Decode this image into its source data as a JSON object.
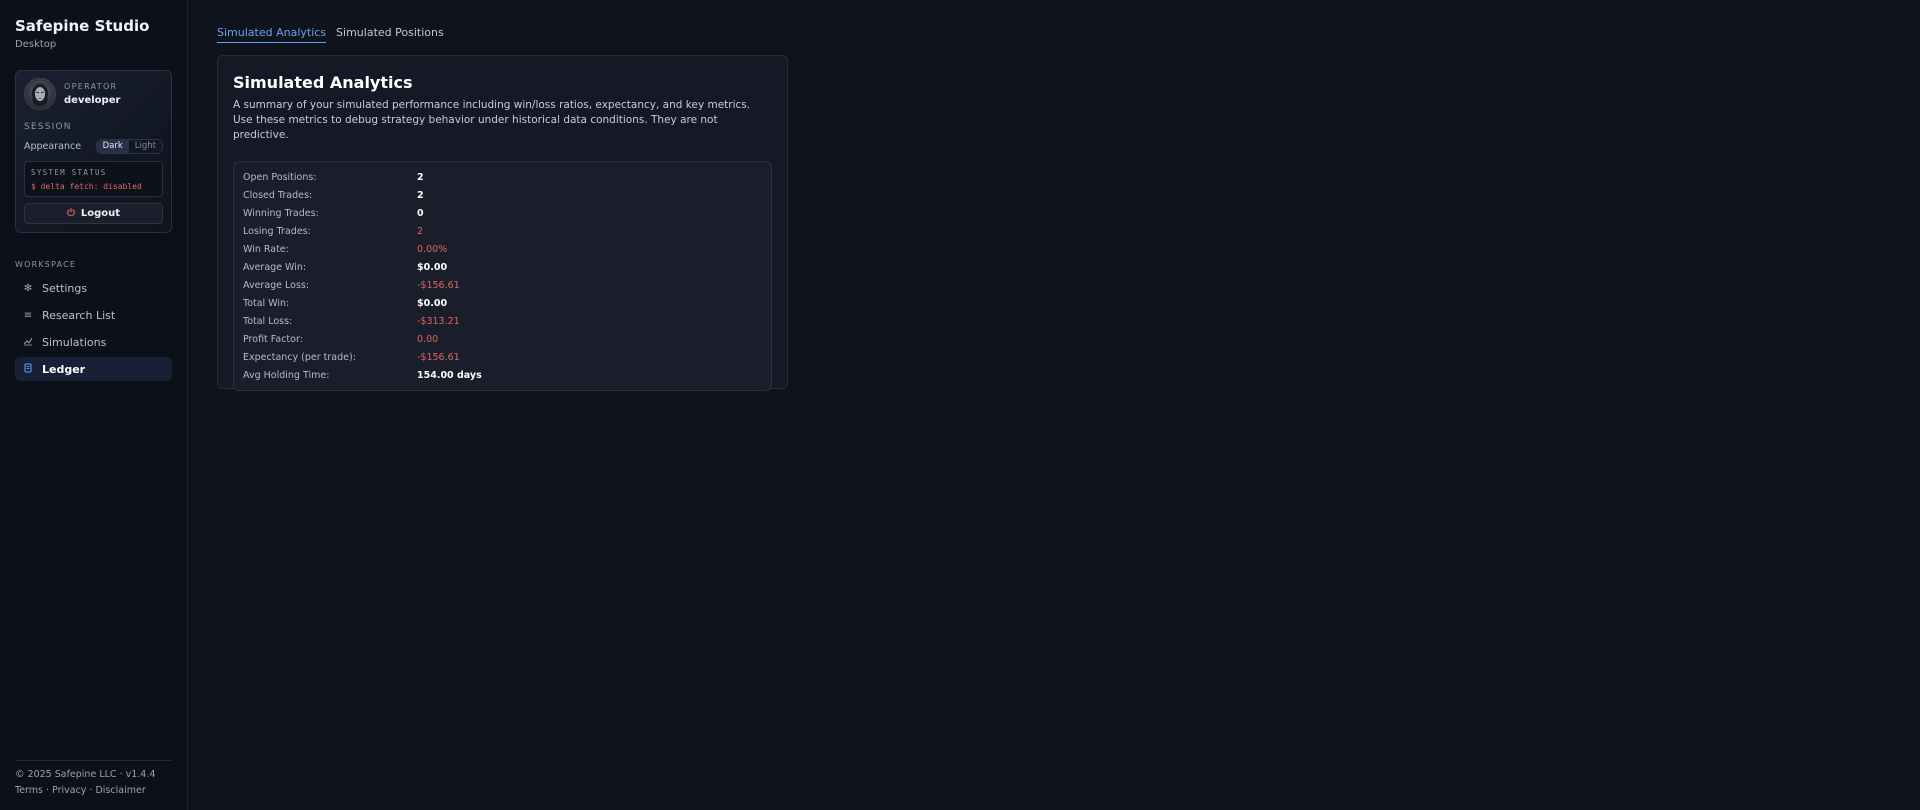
{
  "brand": {
    "title": "Safepine Studio",
    "subtitle": "Desktop"
  },
  "user": {
    "operator_label": "OPERATOR",
    "name": "developer"
  },
  "session": {
    "label": "SESSION",
    "appearance_label": "Appearance",
    "appearance_options": [
      "Dark",
      "Light"
    ],
    "appearance_selected": "Dark",
    "status_label": "SYSTEM STATUS",
    "status_line": "$ delta fetch: disabled",
    "logout_label": "Logout"
  },
  "workspace": {
    "label": "WORKSPACE",
    "items": [
      {
        "label": "Settings",
        "icon": "gear-icon",
        "active": false
      },
      {
        "label": "Research List",
        "icon": "list-icon",
        "active": false
      },
      {
        "label": "Simulations",
        "icon": "chart-icon",
        "active": false
      },
      {
        "label": "Ledger",
        "icon": "book-icon",
        "active": true
      }
    ]
  },
  "footer": {
    "copyright": "© 2025 Safepine LLC · v1.4.4",
    "links": "Terms · Privacy · Disclaimer"
  },
  "tabs": [
    {
      "label": "Simulated Analytics",
      "active": true
    },
    {
      "label": "Simulated Positions",
      "active": false
    }
  ],
  "panel": {
    "title": "Simulated Analytics",
    "description": "A summary of your simulated performance including win/loss ratios, expectancy, and key metrics. Use these metrics to debug strategy behavior under historical data conditions. They are not predictive."
  },
  "metrics": [
    {
      "label": "Open Positions:",
      "value": "2",
      "negative": false
    },
    {
      "label": "Closed Trades:",
      "value": "2",
      "negative": false
    },
    {
      "label": "Winning Trades:",
      "value": "0",
      "negative": false
    },
    {
      "label": "Losing Trades:",
      "value": "2",
      "negative": true
    },
    {
      "label": "Win Rate:",
      "value": "0.00%",
      "negative": true
    },
    {
      "label": "Average Win:",
      "value": "$0.00",
      "negative": false
    },
    {
      "label": "Average Loss:",
      "value": "-$156.61",
      "negative": true
    },
    {
      "label": "Total Win:",
      "value": "$0.00",
      "negative": false
    },
    {
      "label": "Total Loss:",
      "value": "-$313.21",
      "negative": true
    },
    {
      "label": "Profit Factor:",
      "value": "0.00",
      "negative": true
    },
    {
      "label": "Expectancy (per trade):",
      "value": "-$156.61",
      "negative": true
    },
    {
      "label": "Avg Holding Time:",
      "value": "154.00 days",
      "negative": false
    }
  ],
  "colors": {
    "accent": "#6ea0f0",
    "negative": "#e06464",
    "background": "#0f131c"
  }
}
